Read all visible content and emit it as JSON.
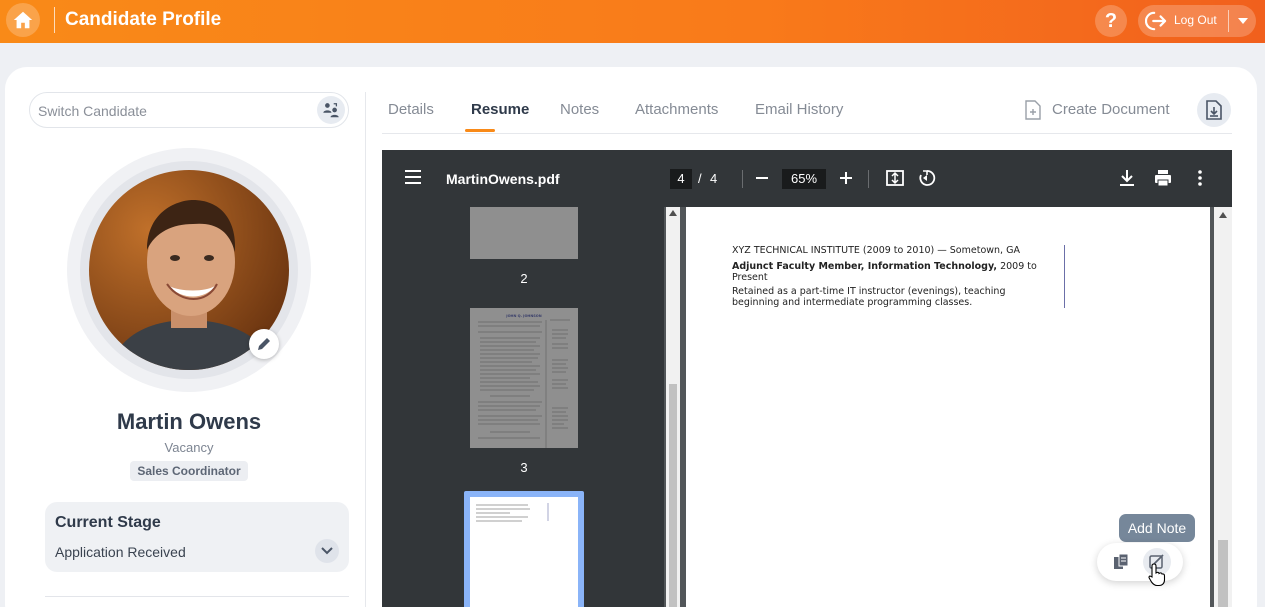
{
  "header": {
    "title": "Candidate Profile",
    "help_label": "?",
    "logout_label": "Log Out"
  },
  "sidebar": {
    "switch_placeholder": "Switch Candidate",
    "candidate_name": "Martin Owens",
    "vacancy_label": "Vacancy",
    "vacancy_value": "Sales Coordinator",
    "stage_title": "Current Stage",
    "stage_value": "Application Received"
  },
  "tabs": [
    {
      "label": "Details"
    },
    {
      "label": "Resume"
    },
    {
      "label": "Notes"
    },
    {
      "label": "Attachments"
    },
    {
      "label": "Email History"
    }
  ],
  "active_tab": "Resume",
  "actions": {
    "create_document": "Create Document"
  },
  "pdf": {
    "filename": "MartinOwens.pdf",
    "current_page": "4",
    "separator": "/",
    "total_pages": "4",
    "zoom": "65%",
    "thumbnails": [
      {
        "number": "2"
      },
      {
        "number": "3"
      }
    ],
    "content": {
      "line1": "XYZ TECHNICAL INSTITUTE (2009 to 2010) — Sometown, GA",
      "line2_bold": "Adjunct Faculty Member, Information Technology,",
      "line2_rest": " 2009 to",
      "line3": "Present",
      "line4": "Retained as a part-time IT instructor (evenings), teaching",
      "line5": "beginning and intermediate programming classes."
    },
    "thumb3_heading": "JOHN Q. JOHNSON"
  },
  "note_actions": {
    "tooltip": "Add Note"
  },
  "colors": {
    "accent": "#f98a18",
    "header_gradient_end": "#f1601d",
    "pdf_toolbar": "#323639",
    "pdf_background": "#525659",
    "tooltip": "#76879a"
  }
}
